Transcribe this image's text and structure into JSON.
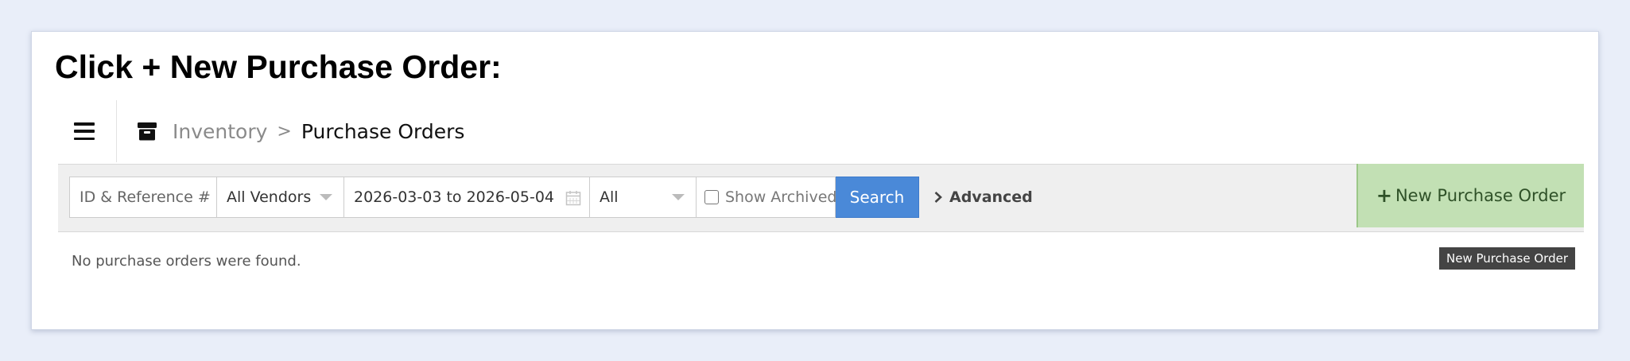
{
  "instruction": "Click + New Purchase Order:",
  "header": {
    "menu_icon": "hamburger-icon",
    "section_icon": "archive-box-icon",
    "breadcrumb": {
      "parent": "Inventory",
      "separator": ">",
      "current": "Purchase Orders"
    }
  },
  "filters": {
    "id_reference": {
      "value": "ID & Reference #"
    },
    "vendor": {
      "selected": "All Vendors"
    },
    "date_range": {
      "value": "2026-03-03 to 2026-05-04"
    },
    "status": {
      "selected": "All"
    },
    "show_archived": {
      "label": "Show Archived",
      "checked": false
    },
    "search_button": "Search",
    "advanced_link": "Advanced"
  },
  "new_purchase_order": {
    "plus": "+",
    "label": "New Purchase Order",
    "tooltip": "New Purchase Order",
    "color": "#c2e0b4"
  },
  "results": {
    "empty_message": "No purchase orders were found."
  },
  "colors": {
    "search_button": "#4a89d8",
    "toolbar_background": "#efefef",
    "page_background": "#e9eef9"
  }
}
